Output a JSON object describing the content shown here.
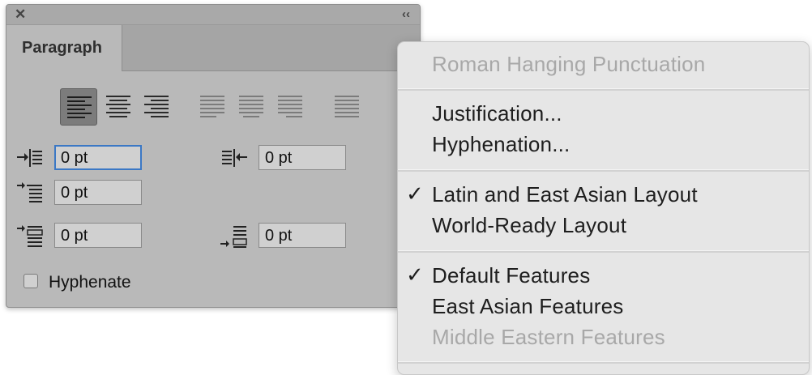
{
  "panel": {
    "close_glyph": "✕",
    "collapse_glyph": "‹‹",
    "tab_label": "Paragraph",
    "left_indent": "0 pt",
    "right_indent": "0 pt",
    "first_line_indent": "0 pt",
    "space_before": "0 pt",
    "space_after": "0 pt",
    "hyphenate_label": "Hyphenate",
    "hyphenate_checked": false
  },
  "menu": {
    "roman_hanging": "Roman Hanging Punctuation",
    "justification": "Justification...",
    "hyphenation": "Hyphenation...",
    "latin_layout": "Latin and East Asian Layout",
    "world_ready": "World-Ready Layout",
    "default_features": "Default Features",
    "east_asian_features": "East Asian Features",
    "middle_eastern_features": "Middle Eastern Features",
    "checkmark": "✓"
  },
  "colors": {
    "panel_bg": "#b9b9b9",
    "focus_border": "#3b78c5",
    "menu_bg": "#e6e6e6",
    "disabled_text": "#a8a8a8"
  }
}
